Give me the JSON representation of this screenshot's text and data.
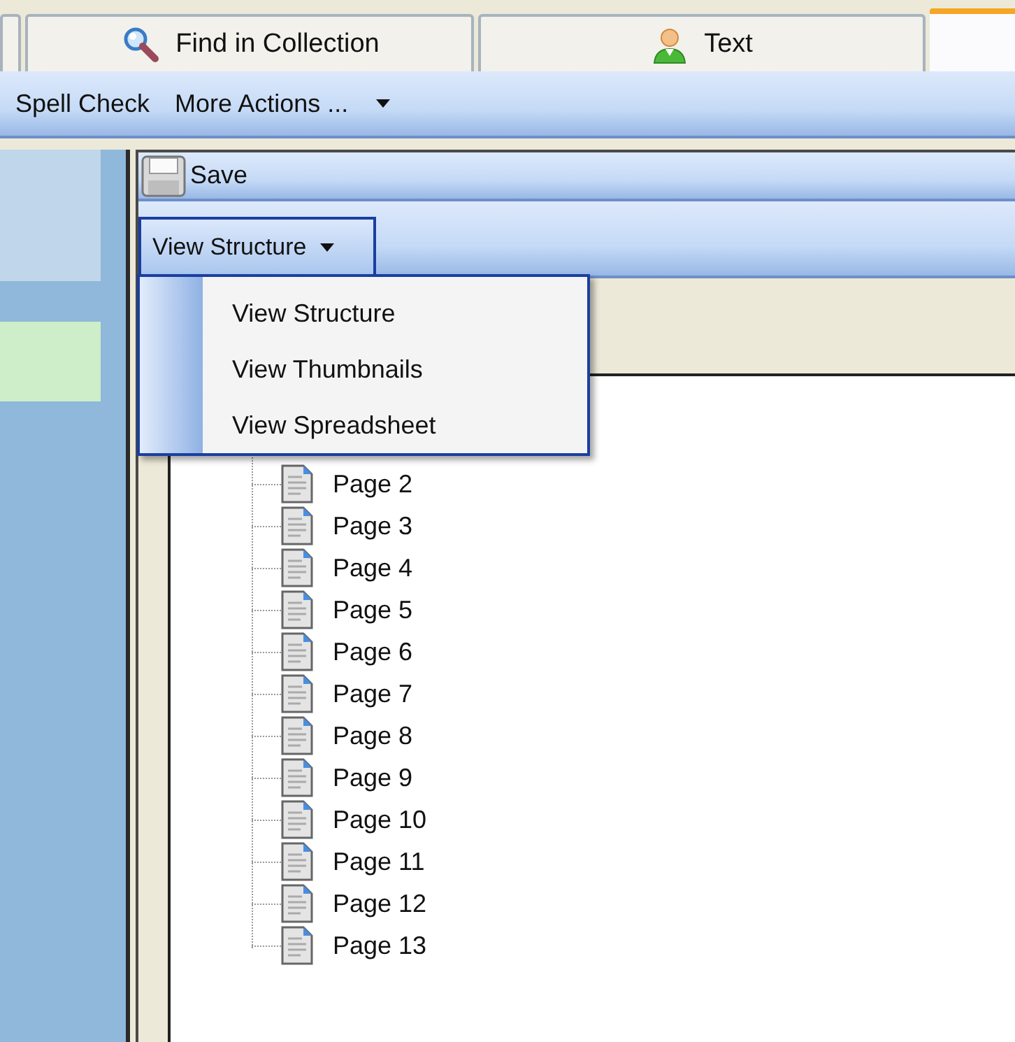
{
  "tabs": [
    {
      "selected": false
    },
    {
      "label": "Find in Collection",
      "selected": false
    },
    {
      "label": "Text",
      "selected": false
    },
    {
      "selected": true
    }
  ],
  "toolbar": {
    "items": [
      "Spell Check",
      "More Actions ..."
    ]
  },
  "side_panels": [
    {
      "color": "#c0d6ea"
    },
    {
      "color": "#cdeec8"
    }
  ],
  "document_toolbar": {
    "save": "Save"
  },
  "view_menu": {
    "label": "View Structure",
    "expanded": true,
    "items": [
      {
        "label": "View Structure",
        "selected": false
      },
      {
        "label": "View Thumbnails",
        "selected": false
      },
      {
        "label": "View Spreadsheet",
        "selected": false
      }
    ]
  },
  "tree": {
    "items": [
      "Page 2",
      "Page 3",
      "Page 4",
      "Page 5",
      "Page 6",
      "Page 7",
      "Page 8",
      "Page 9",
      "Page 10",
      "Page 11",
      "Page 12",
      "Page 13"
    ]
  }
}
